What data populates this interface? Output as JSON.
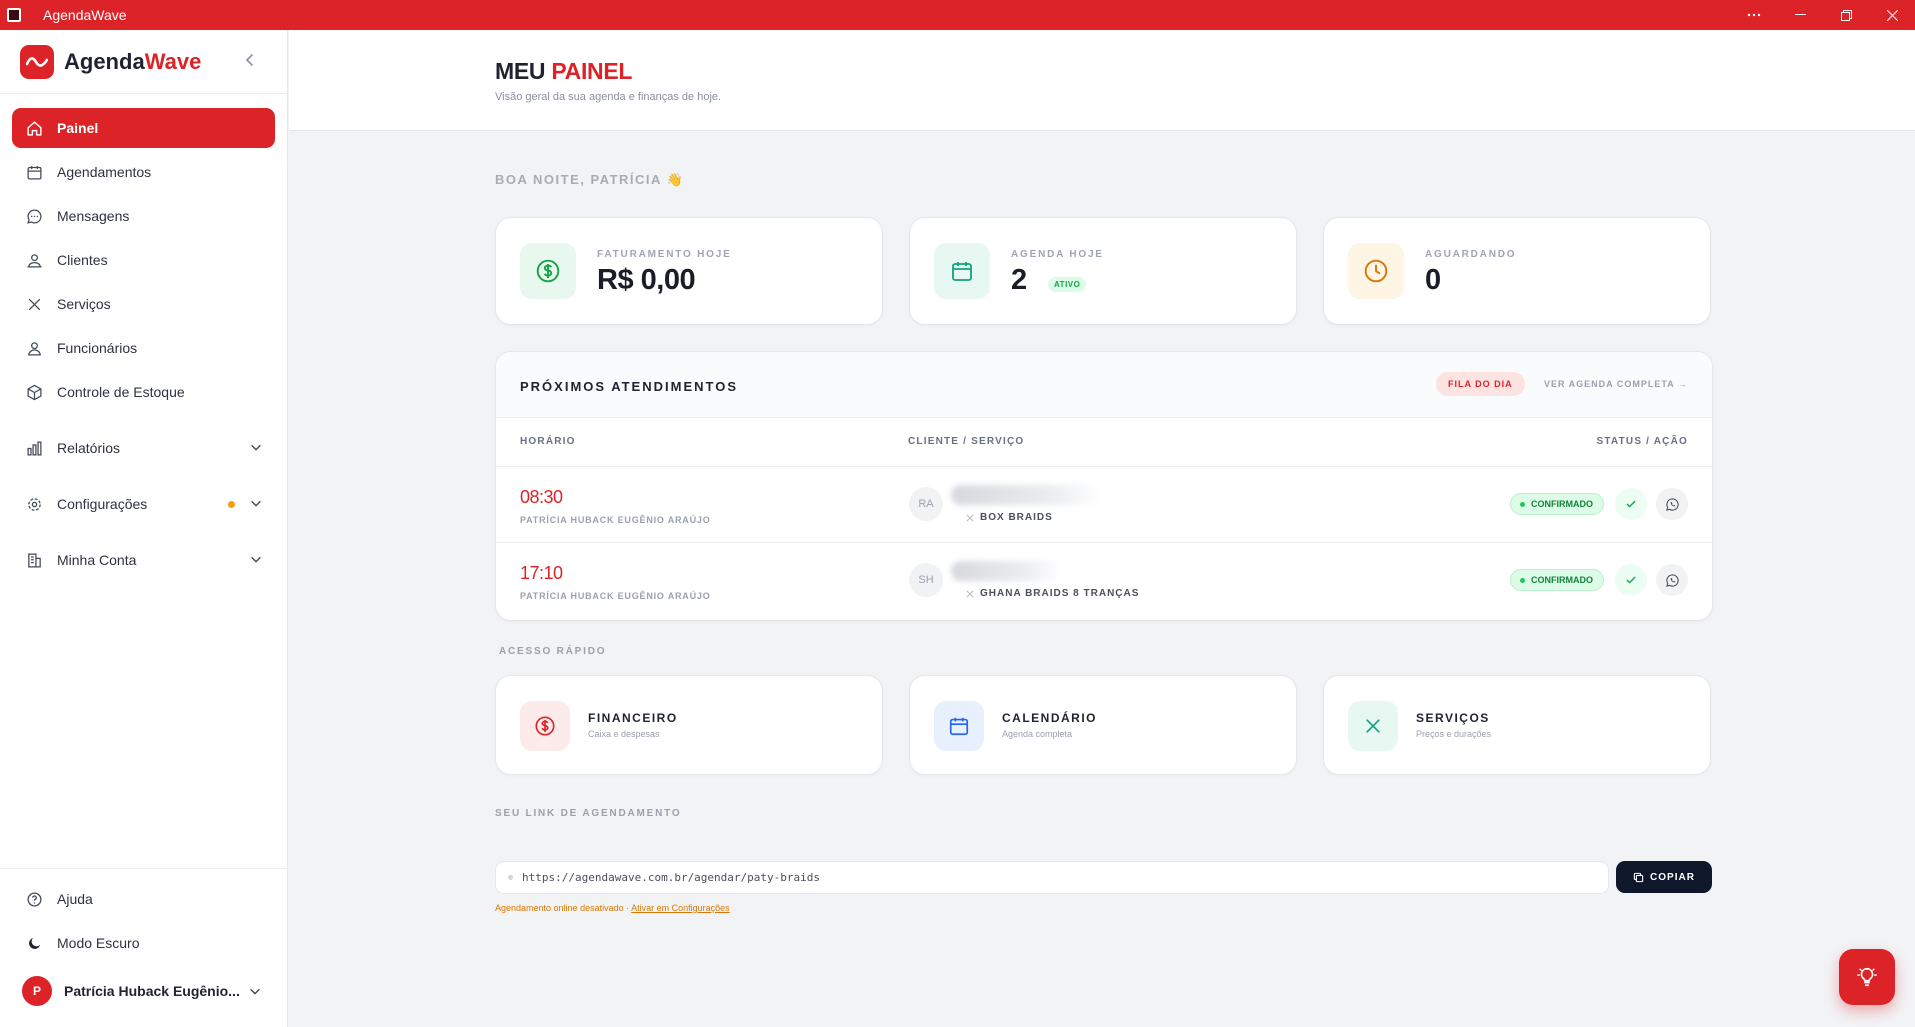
{
  "window": {
    "title": "AgendaWave"
  },
  "brand": {
    "name_part1": "Agenda",
    "name_part2": "Wave"
  },
  "sidebar": {
    "items": [
      {
        "label": "Painel"
      },
      {
        "label": "Agendamentos"
      },
      {
        "label": "Mensagens"
      },
      {
        "label": "Clientes"
      },
      {
        "label": "Serviços"
      },
      {
        "label": "Funcionários"
      },
      {
        "label": "Controle de Estoque"
      },
      {
        "label": "Relatórios"
      },
      {
        "label": "Configurações"
      },
      {
        "label": "Minha Conta"
      }
    ],
    "bottom": {
      "help": "Ajuda",
      "dark_mode": "Modo Escuro",
      "user_initial": "P",
      "user_name": "Patrícia Huback Eugênio..."
    }
  },
  "header": {
    "title_part1": "MEU",
    "title_part2": "PAINEL",
    "subtitle": "Visão geral da sua agenda e finanças de hoje."
  },
  "greeting": "BOA NOITE, PATRÍCIA 👋",
  "stats": [
    {
      "label": "FATURAMENTO HOJE",
      "value": "R$ 0,00"
    },
    {
      "label": "AGENDA HOJE",
      "value": "2",
      "badge": "ATIVO"
    },
    {
      "label": "AGUARDANDO",
      "value": "0"
    }
  ],
  "upcoming": {
    "title": "PRÓXIMOS ATENDIMENTOS",
    "queue_label": "FILA DO DIA",
    "full_agenda_label": "VER AGENDA COMPLETA →",
    "columns": [
      "HORÁRIO",
      "CLIENTE / SERVIÇO",
      "STATUS / AÇÃO"
    ],
    "rows": [
      {
        "time": "08:30",
        "professional": "PATRÍCIA HUBACK EUGÊNIO ARAÚJO",
        "initials": "RA",
        "service": "BOX BRAIDS",
        "status": "CONFIRMADO"
      },
      {
        "time": "17:10",
        "professional": "PATRÍCIA HUBACK EUGÊNIO ARAÚJO",
        "initials": "SH",
        "service": "GHANA BRAIDS 8 TRANÇAS",
        "status": "CONFIRMADO"
      }
    ]
  },
  "quick_access": {
    "label": "ACESSO RÁPIDO",
    "items": [
      {
        "title": "FINANCEIRO",
        "subtitle": "Caixa e despesas"
      },
      {
        "title": "CALENDÁRIO",
        "subtitle": "Agenda completa"
      },
      {
        "title": "SERVIÇOS",
        "subtitle": "Preços e durações"
      }
    ]
  },
  "booking_link": {
    "label": "SEU LINK DE AGENDAMENTO",
    "url": "https://agendawave.com.br/agendar/paty-braids",
    "copy_label": "COPIAR",
    "warning": "Agendamento online desativado ·",
    "warning_link": "Ativar em Configurações"
  },
  "colors": {
    "accent": "#dc2328",
    "success": "#16a34a",
    "warning": "#f59e0b",
    "dark": "#0f172a"
  }
}
